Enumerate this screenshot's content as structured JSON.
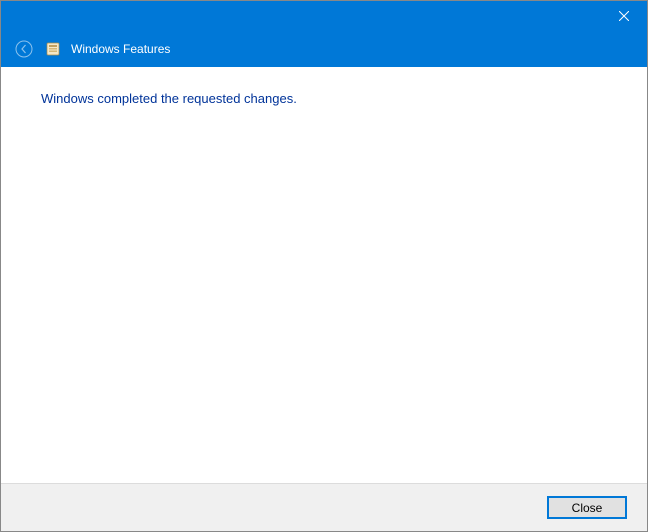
{
  "window": {
    "title": "Windows Features"
  },
  "content": {
    "message": "Windows completed the requested changes."
  },
  "footer": {
    "close_label": "Close"
  }
}
